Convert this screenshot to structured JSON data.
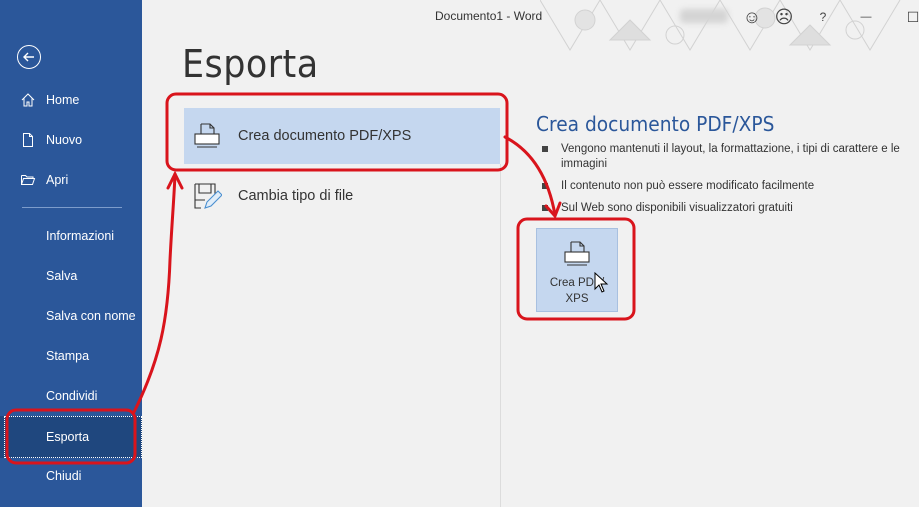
{
  "window": {
    "title": "Documento1 - Word",
    "buttons": [
      {
        "name": "smiley-feedback",
        "icon": "smiley-icon",
        "glyph": "☺"
      },
      {
        "name": "frown-feedback",
        "icon": "frown-icon",
        "glyph": "☹"
      },
      {
        "name": "help",
        "icon": "help-icon",
        "glyph": "?"
      },
      {
        "name": "minimize",
        "icon": "minimize-icon",
        "glyph": "—"
      },
      {
        "name": "maximize",
        "icon": "maximize-icon",
        "glyph": "☐"
      }
    ]
  },
  "sidebar": {
    "back_icon": "back-arrow-icon",
    "top_items": [
      {
        "label": "Home",
        "icon": "home-icon"
      },
      {
        "label": "Nuovo",
        "icon": "new-document-icon"
      },
      {
        "label": "Apri",
        "icon": "folder-open-icon"
      }
    ],
    "items": [
      {
        "label": "Informazioni"
      },
      {
        "label": "Salva"
      },
      {
        "label": "Salva con nome"
      },
      {
        "label": "Stampa"
      },
      {
        "label": "Condividi"
      },
      {
        "label": "Esporta",
        "active": true
      },
      {
        "label": "Chiudi"
      }
    ]
  },
  "main": {
    "title": "Esporta",
    "options": [
      {
        "label": "Crea documento PDF/XPS",
        "icon": "pdf-document-icon",
        "selected": true
      },
      {
        "label": "Cambia tipo di file",
        "icon": "change-file-type-icon",
        "selected": false
      }
    ],
    "detail": {
      "title": "Crea documento PDF/XPS",
      "bullets": [
        "Vengono mantenuti il layout, la formattazione, i tipi di carattere e le immagini",
        "Il contenuto non può essere modificato facilmente",
        "Sul Web sono disponibili visualizzatori gratuiti"
      ],
      "button_line1": "Crea PDF/",
      "button_line2": "XPS"
    }
  },
  "colors": {
    "sidebar": "#2b579a",
    "sidebar_active": "#1f477e",
    "selection": "#c5d7ef",
    "accent_text": "#2b579a",
    "annotation": "#d9141c"
  }
}
